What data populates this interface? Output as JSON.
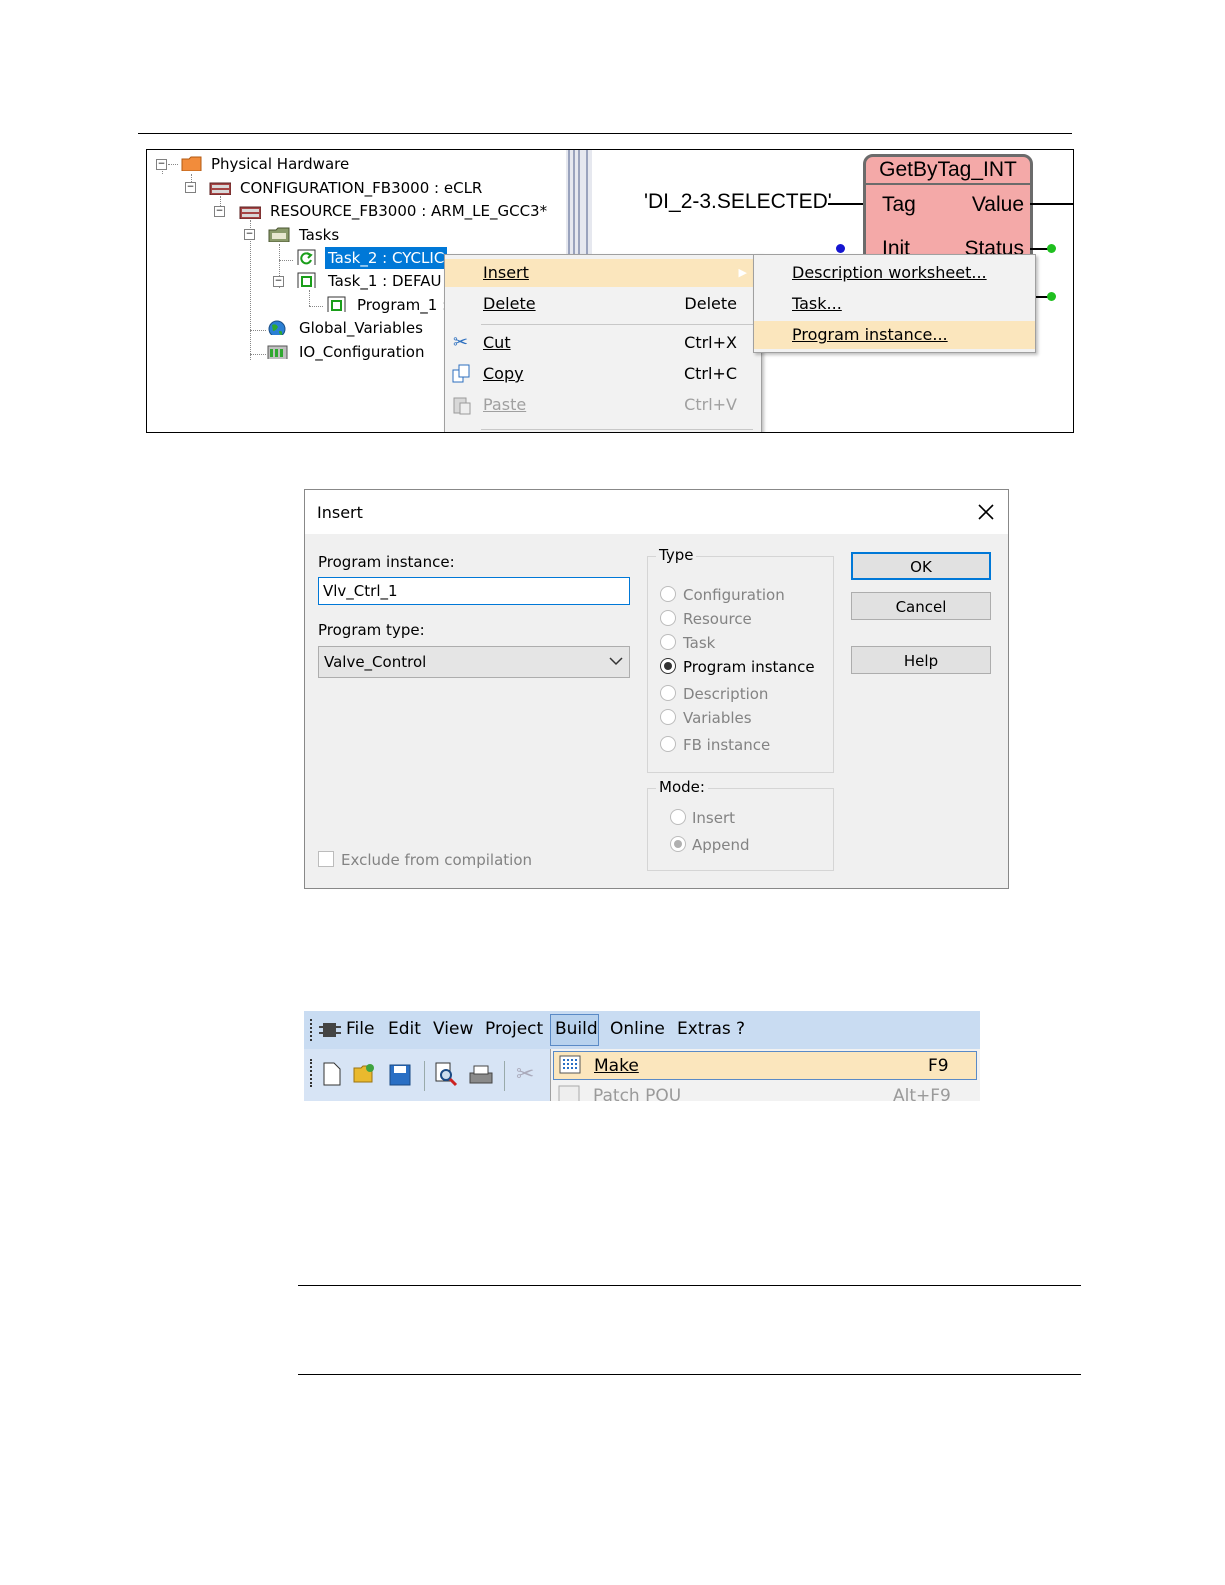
{
  "tree": {
    "items": [
      {
        "label": "Physical Hardware"
      },
      {
        "label": "CONFIGURATION_FB3000 : eCLR"
      },
      {
        "label": "RESOURCE_FB3000 : ARM_LE_GCC3*"
      },
      {
        "label": "Tasks"
      },
      {
        "label": "Task_2 : CYCLIC"
      },
      {
        "label": "Task_1 : DEFAU"
      },
      {
        "label": "Program_1 :"
      },
      {
        "label": "Global_Variables"
      },
      {
        "label": "IO_Configuration"
      }
    ]
  },
  "fbd": {
    "block_title": "GetByTag_INT",
    "tag_literal": "'DI_2-3.SELECTED'",
    "pin_tag": "Tag",
    "pin_value": "Value",
    "pin_init": "Init",
    "pin_status": "Status"
  },
  "context_menu": {
    "items": [
      {
        "label": "Insert",
        "shortcut": ""
      },
      {
        "label": "Delete",
        "shortcut": "Delete"
      },
      {
        "label": "Cut",
        "shortcut": "Ctrl+X"
      },
      {
        "label": "Copy",
        "shortcut": "Ctrl+C"
      },
      {
        "label": "Paste",
        "shortcut": "Ctrl+V"
      }
    ]
  },
  "submenu": {
    "items": [
      {
        "label": "Description worksheet..."
      },
      {
        "label": "Task..."
      },
      {
        "label": "Program instance..."
      }
    ]
  },
  "dialog": {
    "title": "Insert",
    "program_instance_label": "Program instance:",
    "program_instance_value": "Vlv_Ctrl_1",
    "program_type_label": "Program type:",
    "program_type_value": "Valve_Control",
    "exclude_label": "Exclude from compilation",
    "type_group": "Type",
    "type_options": [
      "Configuration",
      "Resource",
      "Task",
      "Program instance",
      "Description",
      "Variables",
      "FB instance"
    ],
    "type_selected": "Program instance",
    "mode_group": "Mode:",
    "mode_options": [
      "Insert",
      "Append"
    ],
    "mode_selected": "Append",
    "ok": "OK",
    "cancel": "Cancel",
    "help": "Help"
  },
  "menubar": {
    "items": [
      "File",
      "Edit",
      "View",
      "Project",
      "Build",
      "Online",
      "Extras",
      "?"
    ],
    "active": "Build"
  },
  "build_menu": {
    "items": [
      {
        "label": "Make",
        "shortcut": "F9"
      },
      {
        "label": "Patch POU",
        "shortcut": "Alt+F9"
      }
    ]
  },
  "colors": {
    "selection": "#0078d7",
    "menu_highlight": "#fbe6bd",
    "fb_fill": "#f4a9a8",
    "menubar": "#c9dcf2"
  }
}
